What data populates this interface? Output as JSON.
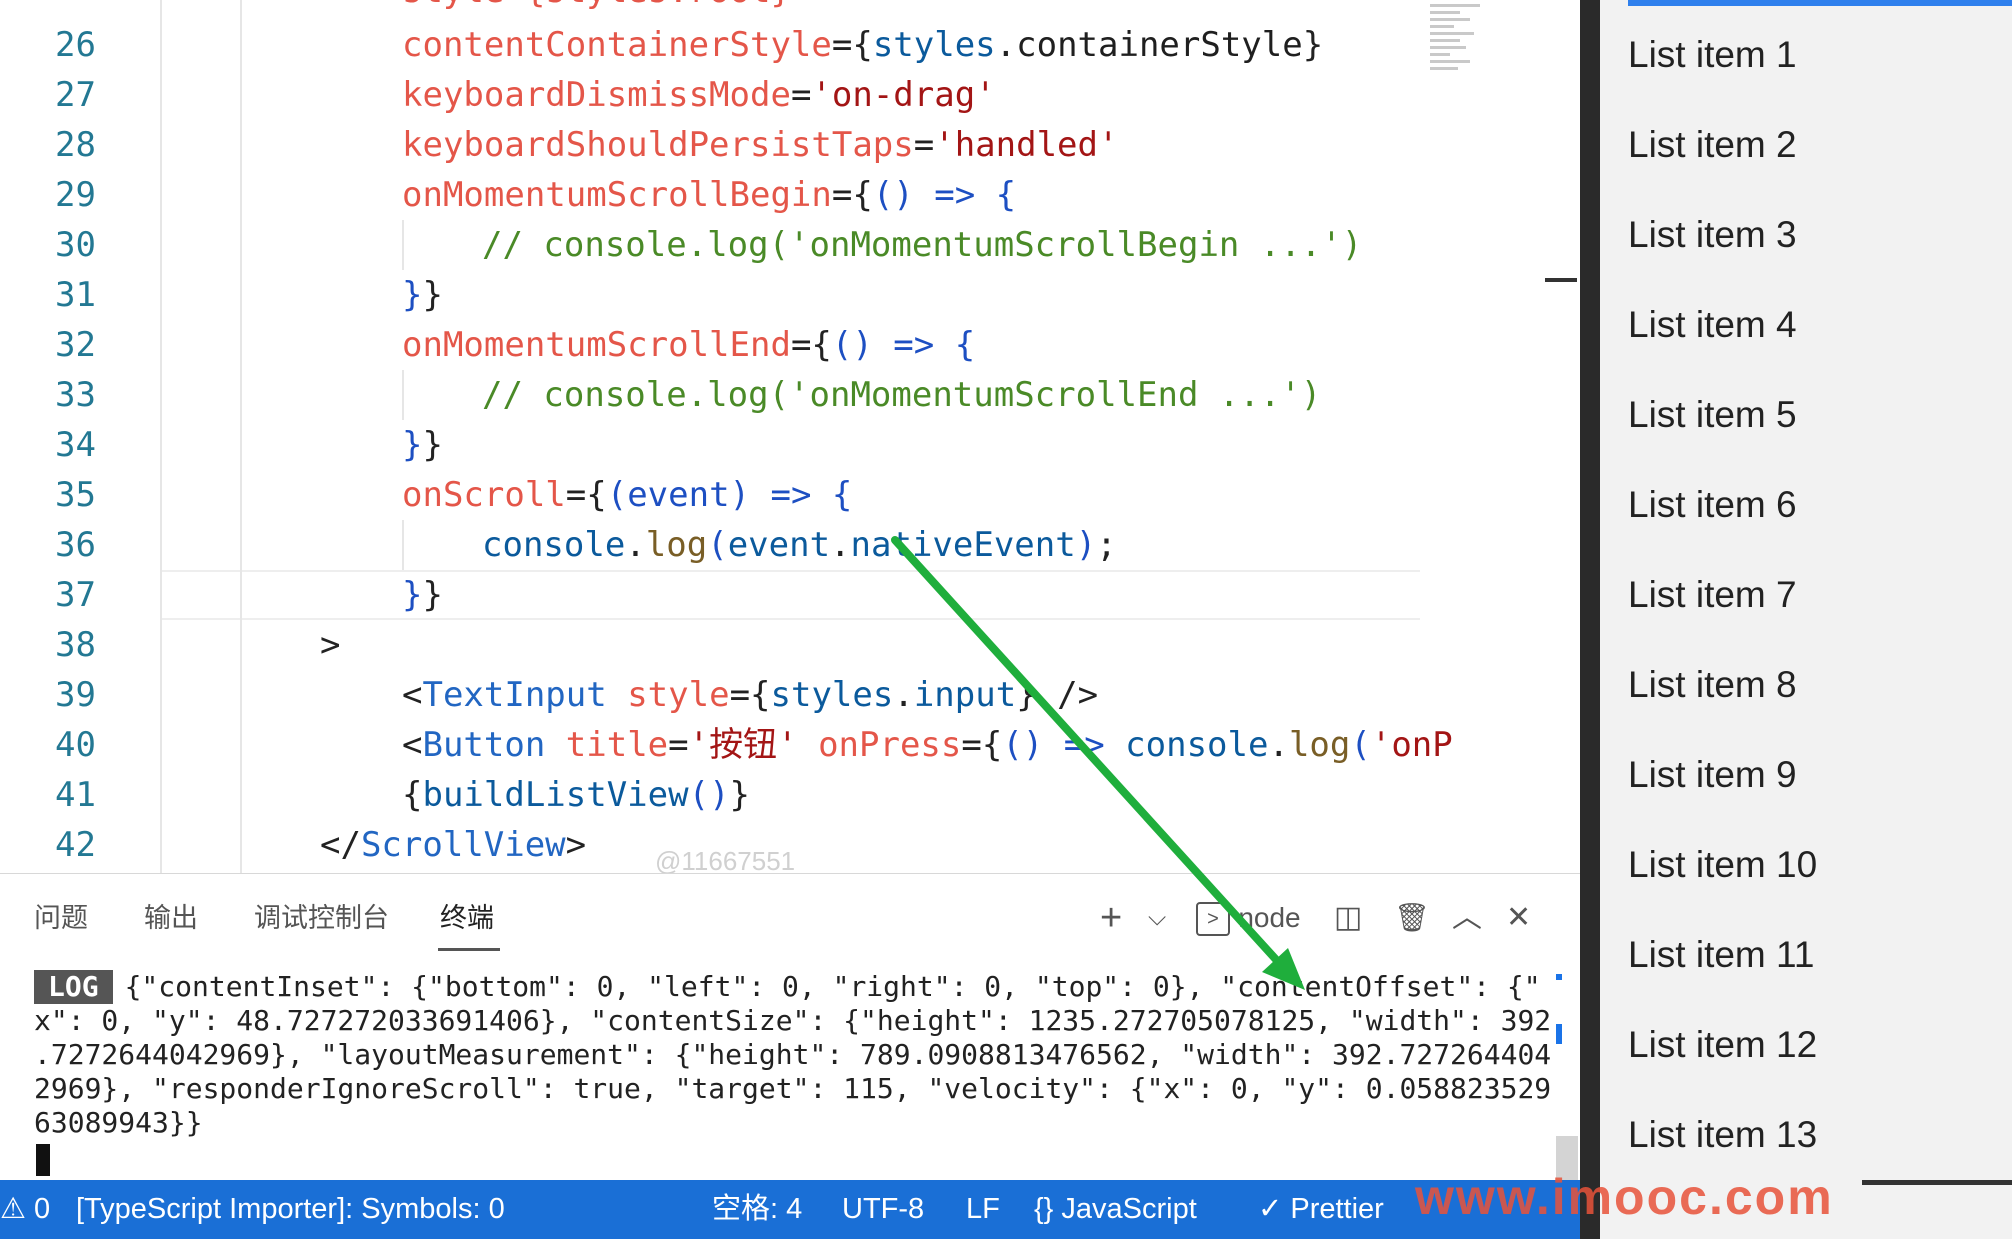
{
  "editor": {
    "partial_top_text": "style={styles.root}",
    "lines": [
      {
        "no": "26",
        "tokens": [
          [
            "attr",
            "contentContainerStyle"
          ],
          [
            "pun",
            "={"
          ],
          [
            "obj",
            "styles"
          ],
          [
            "pun",
            "."
          ],
          [
            "prop",
            "containerStyle"
          ],
          [
            "pun",
            "}"
          ]
        ]
      },
      {
        "no": "27",
        "tokens": [
          [
            "attr",
            "keyboardDismissMode"
          ],
          [
            "pun",
            "="
          ],
          [
            "str",
            "'on-drag'"
          ]
        ]
      },
      {
        "no": "28",
        "tokens": [
          [
            "attr",
            "keyboardShouldPersistTaps"
          ],
          [
            "pun",
            "="
          ],
          [
            "str",
            "'handled'"
          ]
        ]
      },
      {
        "no": "29",
        "tokens": [
          [
            "attr",
            "onMomentumScrollBegin"
          ],
          [
            "pun",
            "={"
          ],
          [
            "br",
            "() => {"
          ]
        ]
      },
      {
        "no": "30",
        "tokens": [
          [
            "cmt",
            "// console.log('onMomentumScrollBegin ...')"
          ]
        ]
      },
      {
        "no": "31",
        "tokens": [
          [
            "br",
            "}"
          ],
          [
            "pun",
            "}"
          ]
        ]
      },
      {
        "no": "32",
        "tokens": [
          [
            "attr",
            "onMomentumScrollEnd"
          ],
          [
            "pun",
            "={"
          ],
          [
            "br",
            "() => {"
          ]
        ]
      },
      {
        "no": "33",
        "tokens": [
          [
            "cmt",
            "// console.log('onMomentumScrollEnd ...')"
          ]
        ]
      },
      {
        "no": "34",
        "tokens": [
          [
            "br",
            "}"
          ],
          [
            "pun",
            "}"
          ]
        ]
      },
      {
        "no": "35",
        "tokens": [
          [
            "attr",
            "onScroll"
          ],
          [
            "pun",
            "={"
          ],
          [
            "br",
            "(event) => {"
          ]
        ]
      },
      {
        "no": "36",
        "tokens": [
          [
            "obj",
            "console"
          ],
          [
            "pun",
            "."
          ],
          [
            "fn",
            "log"
          ],
          [
            "br",
            "("
          ],
          [
            "obj",
            "event"
          ],
          [
            "pun",
            "."
          ],
          [
            "obj",
            "nativeEvent"
          ],
          [
            "br",
            ")"
          ],
          [
            "pun",
            ";"
          ]
        ]
      },
      {
        "no": "37",
        "tokens": [
          [
            "br",
            "}"
          ],
          [
            "pun",
            "}"
          ]
        ]
      },
      {
        "no": "38",
        "tokens": [
          [
            "pun",
            ">"
          ]
        ]
      },
      {
        "no": "39",
        "tokens": [
          [
            "pun",
            "<"
          ],
          [
            "tag",
            "TextInput"
          ],
          [
            "pun",
            " "
          ],
          [
            "attr",
            "style"
          ],
          [
            "pun",
            "={"
          ],
          [
            "obj",
            "styles"
          ],
          [
            "pun",
            "."
          ],
          [
            "obj",
            "input"
          ],
          [
            "pun",
            "} />"
          ]
        ]
      },
      {
        "no": "40",
        "tokens": [
          [
            "pun",
            "<"
          ],
          [
            "tag",
            "Button"
          ],
          [
            "pun",
            " "
          ],
          [
            "attr",
            "title"
          ],
          [
            "pun",
            "="
          ],
          [
            "str",
            "'按钮'"
          ],
          [
            "pun",
            " "
          ],
          [
            "attr",
            "onPress"
          ],
          [
            "pun",
            "={"
          ],
          [
            "br",
            "() => "
          ],
          [
            "obj",
            "console"
          ],
          [
            "pun",
            "."
          ],
          [
            "fn",
            "log"
          ],
          [
            "br",
            "("
          ],
          [
            "str",
            "'onP"
          ]
        ]
      },
      {
        "no": "41",
        "tokens": [
          [
            "pun",
            "{"
          ],
          [
            "obj",
            "buildListView"
          ],
          [
            "br",
            "()"
          ],
          [
            "pun",
            "}"
          ]
        ]
      },
      {
        "no": "42",
        "tokens": [
          [
            "pun",
            "</"
          ],
          [
            "tag",
            "ScrollView"
          ],
          [
            "pun",
            ">"
          ]
        ]
      }
    ],
    "watermark": "@11667551"
  },
  "panel": {
    "tabs": [
      "问题",
      "输出",
      "调试控制台",
      "终端"
    ],
    "active_tab": "终端",
    "actions": {
      "new_terminal": "+",
      "dropdown": "⌵",
      "terminal_name": "node",
      "split": "◫",
      "kill": "🗑",
      "maximize": "︿",
      "close": "✕"
    },
    "log_badge": "LOG",
    "log_lines": [
      "{\"contentInset\": {\"bottom\": 0, \"left\": 0, \"right\": 0, \"top\": 0}, \"contentOffset\": {\"",
      "x\": 0, \"y\": 48.727272033691406}, \"contentSize\": {\"height\": 1235.272705078125, \"width\": 392",
      ".7272644042969}, \"layoutMeasurement\": {\"height\": 789.0908813476562, \"width\": 392.727264404",
      "2969}, \"responderIgnoreScroll\": true, \"target\": 115, \"velocity\": {\"x\": 0, \"y\": 0.058823529",
      "63089943}}"
    ]
  },
  "statusbar": {
    "errors": "⚠ 0",
    "importer": "[TypeScript Importer]: Symbols: 0",
    "indent": "空格: 4",
    "encoding": "UTF-8",
    "eol": "LF",
    "language": "{} JavaScript",
    "formatter": "✓ Prettier"
  },
  "phone": {
    "items": [
      "List item 1",
      "List item 2",
      "List item 3",
      "List item 4",
      "List item 5",
      "List item 6",
      "List item 7",
      "List item 8",
      "List item 9",
      "List item 10",
      "List item 11",
      "List item 12",
      "List item 13"
    ]
  },
  "overlay": {
    "site_watermark": "www.imooc.com",
    "arrow_color": "#1fae3c"
  }
}
